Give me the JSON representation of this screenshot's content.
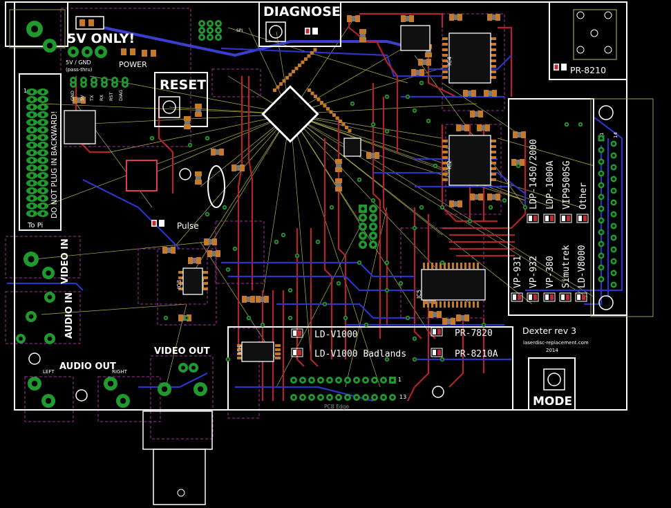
{
  "board": {
    "title_main": "Dexter rev 3",
    "title_url": "laserdisc-replacement.com",
    "title_year": "2014",
    "edge_label": "PCB Edge"
  },
  "buttons": {
    "diagnose": "DIAGNOSE",
    "reset": "RESET",
    "mode": "MODE"
  },
  "labels": {
    "five_v_only": "5V ONLY!",
    "five_v_gnd": "5V / GND",
    "pass_thru": "(pass-thru)",
    "power": "POWER",
    "header_pins": [
      "GND",
      "5V",
      "TX",
      "RX",
      "RST",
      "DIAG"
    ],
    "spi": "SPI",
    "do_not_plug": "DO NOT PLUG IN BACKWARD!",
    "to_pi": "To Pi",
    "pulse": "Pulse",
    "video_in": "VIDEO IN",
    "audio_in": "AUDIO IN",
    "audio_out": "AUDIO OUT",
    "left": "LEFT",
    "right": "RIGHT",
    "video_out": "VIDEO OUT",
    "pr8210": "PR-8210",
    "one": "1",
    "thirteen": "13",
    "fourteen": "14"
  },
  "ic_labels": [
    "IC4",
    "IC2",
    "IC5",
    "IC3",
    "IC6"
  ],
  "player_top_row": [
    "LDP-1450/2000",
    "LDP-1000A",
    "VIP9500SG",
    "Other"
  ],
  "player_bottom_row": [
    "VP-931",
    "VP-932",
    "VP-380",
    "Simutrek",
    "LD-V8000"
  ],
  "player_bottom_left": [
    "LD-V1000",
    "LD-V1000 Badlands"
  ],
  "player_bottom_right": [
    "PR-7820",
    "PR-8210A"
  ],
  "colors": {
    "background": "#000000",
    "silkscreen": "#ffffff",
    "top_copper": "#b4232a",
    "bottom_copper": "#2b35c8",
    "pads": "#1f9a2e",
    "smd": "#c47a2c",
    "keepout": "#b02aa6",
    "airwire": "#b9b447"
  }
}
